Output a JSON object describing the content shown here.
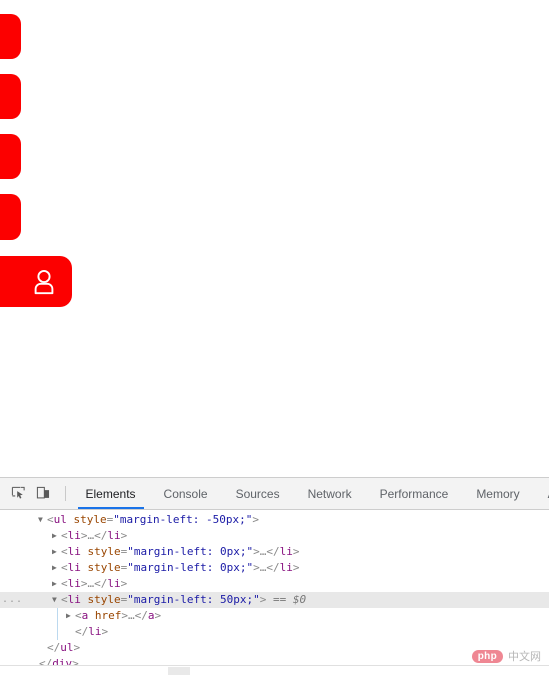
{
  "page": {
    "nav": {
      "items": [
        {
          "id": "nav-block-1",
          "label": ""
        },
        {
          "id": "nav-block-2",
          "label": ""
        },
        {
          "id": "nav-block-3",
          "label": ""
        },
        {
          "id": "nav-block-4",
          "label": ""
        },
        {
          "id": "nav-block-user",
          "label": "",
          "icon": "user-icon"
        }
      ],
      "accent_color": "#fc0000",
      "icon_color": "#ffffff"
    }
  },
  "devtools": {
    "toolbar": {
      "inspect_icon": "inspect-element-icon",
      "device_icon": "device-toolbar-icon",
      "tabs": [
        {
          "label": "Elements",
          "active": true
        },
        {
          "label": "Console",
          "active": false
        },
        {
          "label": "Sources",
          "active": false
        },
        {
          "label": "Network",
          "active": false
        },
        {
          "label": "Performance",
          "active": false
        },
        {
          "label": "Memory",
          "active": false
        },
        {
          "label": "Applica",
          "active": false
        }
      ],
      "active_tab_color": "#1a73e8"
    },
    "dom_tree": {
      "rows": [
        {
          "indent": 1,
          "marker": "expanded",
          "selected": false,
          "ellipsis": "",
          "parts": [
            {
              "t": "<",
              "c": "punct"
            },
            {
              "t": "ul",
              "c": "tag"
            },
            {
              "t": " ",
              "c": "punct"
            },
            {
              "t": "style",
              "c": "attr"
            },
            {
              "t": "=",
              "c": "punct"
            },
            {
              "t": "\"margin-left: -50px;\"",
              "c": "val"
            },
            {
              "t": ">",
              "c": "punct"
            }
          ]
        },
        {
          "indent": 2,
          "marker": "collapsed",
          "selected": false,
          "ellipsis": "",
          "parts": [
            {
              "t": "<",
              "c": "punct"
            },
            {
              "t": "li",
              "c": "tag"
            },
            {
              "t": ">",
              "c": "punct"
            },
            {
              "t": "…",
              "c": "ellip"
            },
            {
              "t": "</",
              "c": "punct"
            },
            {
              "t": "li",
              "c": "tag"
            },
            {
              "t": ">",
              "c": "punct"
            }
          ]
        },
        {
          "indent": 2,
          "marker": "collapsed",
          "selected": false,
          "ellipsis": "",
          "parts": [
            {
              "t": "<",
              "c": "punct"
            },
            {
              "t": "li",
              "c": "tag"
            },
            {
              "t": " ",
              "c": "punct"
            },
            {
              "t": "style",
              "c": "attr"
            },
            {
              "t": "=",
              "c": "punct"
            },
            {
              "t": "\"margin-left: 0px;\"",
              "c": "val"
            },
            {
              "t": ">",
              "c": "punct"
            },
            {
              "t": "…",
              "c": "ellip"
            },
            {
              "t": "</",
              "c": "punct"
            },
            {
              "t": "li",
              "c": "tag"
            },
            {
              "t": ">",
              "c": "punct"
            }
          ]
        },
        {
          "indent": 2,
          "marker": "collapsed",
          "selected": false,
          "ellipsis": "",
          "parts": [
            {
              "t": "<",
              "c": "punct"
            },
            {
              "t": "li",
              "c": "tag"
            },
            {
              "t": " ",
              "c": "punct"
            },
            {
              "t": "style",
              "c": "attr"
            },
            {
              "t": "=",
              "c": "punct"
            },
            {
              "t": "\"margin-left: 0px;\"",
              "c": "val"
            },
            {
              "t": ">",
              "c": "punct"
            },
            {
              "t": "…",
              "c": "ellip"
            },
            {
              "t": "</",
              "c": "punct"
            },
            {
              "t": "li",
              "c": "tag"
            },
            {
              "t": ">",
              "c": "punct"
            }
          ]
        },
        {
          "indent": 2,
          "marker": "collapsed",
          "selected": false,
          "ellipsis": "",
          "parts": [
            {
              "t": "<",
              "c": "punct"
            },
            {
              "t": "li",
              "c": "tag"
            },
            {
              "t": ">",
              "c": "punct"
            },
            {
              "t": "…",
              "c": "ellip"
            },
            {
              "t": "</",
              "c": "punct"
            },
            {
              "t": "li",
              "c": "tag"
            },
            {
              "t": ">",
              "c": "punct"
            }
          ]
        },
        {
          "indent": 2,
          "marker": "expanded",
          "selected": true,
          "ellipsis": "...",
          "parts": [
            {
              "t": "<",
              "c": "punct"
            },
            {
              "t": "li",
              "c": "tag"
            },
            {
              "t": " ",
              "c": "punct"
            },
            {
              "t": "style",
              "c": "attr"
            },
            {
              "t": "=",
              "c": "punct"
            },
            {
              "t": "\"margin-left: 50px;\"",
              "c": "val"
            },
            {
              "t": ">",
              "c": "punct"
            },
            {
              "t": "  == $0",
              "c": "sel0"
            }
          ]
        },
        {
          "indent": 3,
          "marker": "collapsed",
          "selected": false,
          "ellipsis": "",
          "guide": true,
          "parts": [
            {
              "t": "<",
              "c": "punct"
            },
            {
              "t": "a",
              "c": "tag"
            },
            {
              "t": " ",
              "c": "punct"
            },
            {
              "t": "href",
              "c": "attr"
            },
            {
              "t": ">",
              "c": "punct"
            },
            {
              "t": "…",
              "c": "ellip"
            },
            {
              "t": "</",
              "c": "punct"
            },
            {
              "t": "a",
              "c": "tag"
            },
            {
              "t": ">",
              "c": "punct"
            }
          ]
        },
        {
          "indent": 3,
          "marker": "none",
          "selected": false,
          "ellipsis": "",
          "guide": true,
          "parts": [
            {
              "t": "</",
              "c": "punct"
            },
            {
              "t": "li",
              "c": "tag"
            },
            {
              "t": ">",
              "c": "punct"
            }
          ]
        },
        {
          "indent": 1,
          "marker": "none",
          "selected": false,
          "ellipsis": "",
          "parts": [
            {
              "t": "</",
              "c": "punct"
            },
            {
              "t": "ul",
              "c": "tag"
            },
            {
              "t": ">",
              "c": "punct"
            }
          ]
        },
        {
          "indent": 0,
          "marker": "none",
          "selected": false,
          "ellipsis": "",
          "parts": [
            {
              "t": "</",
              "c": "punct"
            },
            {
              "t": "div",
              "c": "tag"
            },
            {
              "t": ">",
              "c": "punct"
            }
          ]
        }
      ]
    },
    "scrollbar": {
      "orientation": "horizontal"
    }
  },
  "watermark": {
    "badge": "php",
    "text": "中文网"
  }
}
